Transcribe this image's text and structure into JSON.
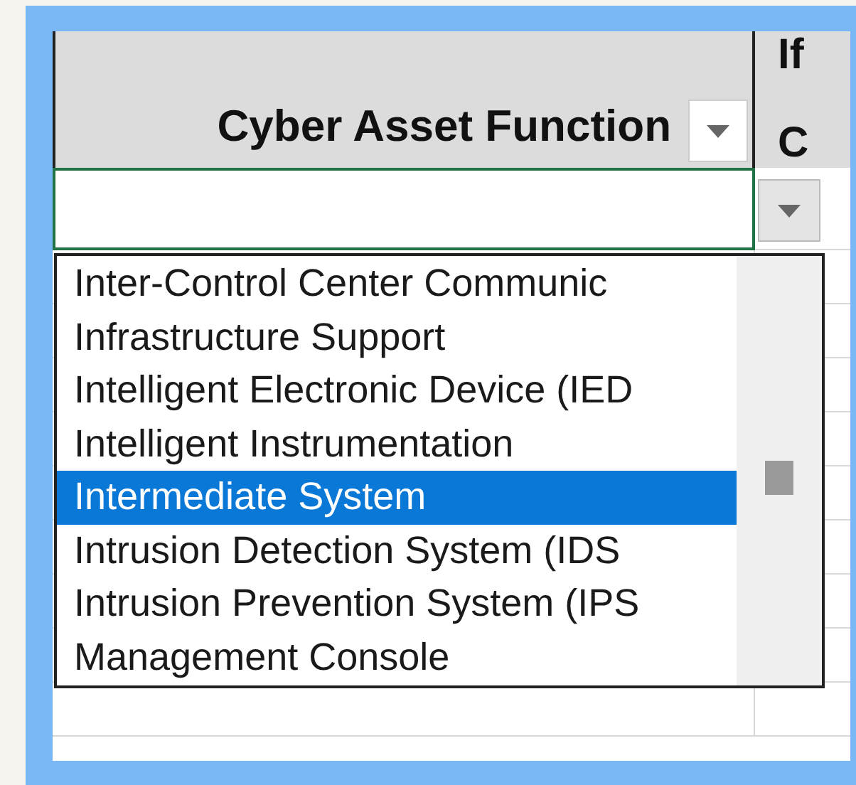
{
  "header": {
    "label": "Cyber Asset Function"
  },
  "next_column_header": {
    "lines": [
      "If",
      "C"
    ]
  },
  "dropdown": {
    "items": [
      {
        "label": "Inter-Control Center Communic",
        "selected": false
      },
      {
        "label": "Infrastructure Support",
        "selected": false
      },
      {
        "label": "Intelligent Electronic Device (IED",
        "selected": false
      },
      {
        "label": "Intelligent Instrumentation",
        "selected": false
      },
      {
        "label": "Intermediate System",
        "selected": true
      },
      {
        "label": "Intrusion Detection System (IDS",
        "selected": false
      },
      {
        "label": "Intrusion Prevention System (IPS",
        "selected": false
      },
      {
        "label": "Management Console",
        "selected": false
      }
    ]
  }
}
